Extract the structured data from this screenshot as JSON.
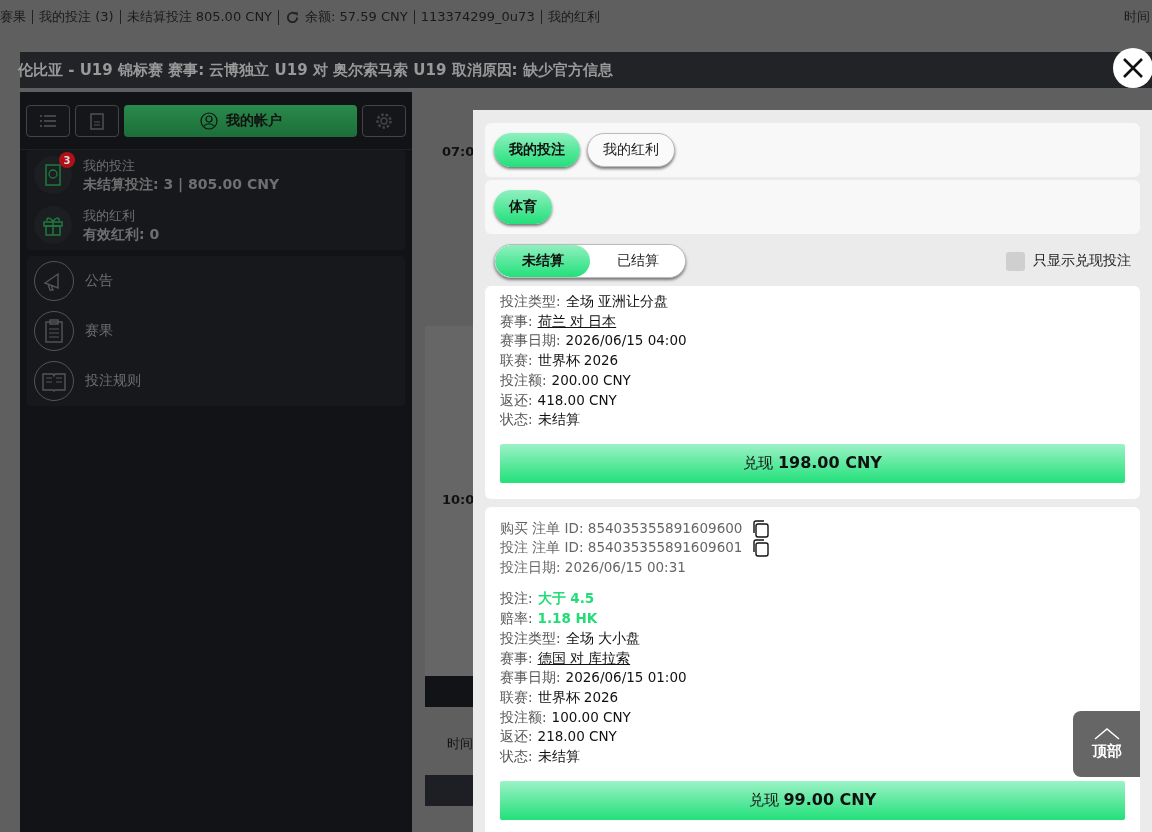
{
  "top_bar": {
    "items": [
      {
        "kind": "link",
        "text": "赛果"
      },
      {
        "kind": "link",
        "text": "我的投注 (3)"
      },
      {
        "kind": "link",
        "text": "未结算投注 805.00 CNY"
      },
      {
        "kind": "balance",
        "text": "余额:  57.59 CNY"
      },
      {
        "kind": "link",
        "text": "113374299_0u73"
      },
      {
        "kind": "link",
        "text": "我的红利"
      }
    ],
    "right": "时间"
  },
  "banner": "伦比亚 - U19 锦标赛 赛事: 云博独立 U19 对 奥尔索马索 U19 取消原因: 缺少官方信息",
  "sidebar": {
    "account_button": "我的帐户",
    "summary": [
      {
        "kind": "bets",
        "title": "我的投注",
        "detail": "未结算投注: 3 | 805.00 CNY",
        "badge": "3"
      },
      {
        "kind": "bonus",
        "title": "我的红利",
        "detail": "有效红利: 0"
      }
    ],
    "menu": [
      {
        "kind": "announcement",
        "label": "公告"
      },
      {
        "kind": "results",
        "label": "赛果"
      },
      {
        "kind": "rules",
        "label": "投注规则"
      }
    ]
  },
  "schedule": {
    "times": [
      "07:0",
      "10:0"
    ],
    "label": "时间"
  },
  "modal": {
    "tabs": [
      {
        "label": "我的投注",
        "selected": true
      },
      {
        "label": "我的红利",
        "selected": false
      }
    ],
    "categories": [
      {
        "label": "体育",
        "selected": true
      }
    ],
    "status_toggle": [
      {
        "label": "未结算",
        "selected": true
      },
      {
        "label": "已结算",
        "selected": false
      }
    ],
    "filter": {
      "label": "只显示兑现投注",
      "checked": false
    },
    "bets": [
      {
        "details": [
          {
            "kind": "text",
            "label": "投注类型:",
            "value": "全场 亚洲让分盘"
          },
          {
            "kind": "link",
            "label": "赛事:",
            "value": "荷兰 对 日本"
          },
          {
            "kind": "text",
            "label": "赛事日期:",
            "value": "2026/06/15 04:00"
          },
          {
            "kind": "text",
            "label": "联赛:",
            "value": "世界杯 2026"
          },
          {
            "kind": "text",
            "label": "投注额:",
            "value": "200.00 CNY"
          },
          {
            "kind": "text",
            "label": "返还:",
            "value": "418.00 CNY"
          },
          {
            "kind": "text",
            "label": "状态:",
            "value": "未结算"
          }
        ],
        "cashout": {
          "label": "兑现",
          "amount": "198.00 CNY"
        }
      },
      {
        "meta": [
          {
            "text": "购买 注单 ID: 854035355891609600",
            "copy": true
          },
          {
            "text": "投注 注单 ID: 854035355891609601",
            "copy": true
          },
          {
            "text": "投注日期: 2026/06/15 00:31",
            "copy": false
          }
        ],
        "details": [
          {
            "kind": "highlight",
            "label": "投注:",
            "value": "大于 4.5"
          },
          {
            "kind": "highlight",
            "label": "赔率:",
            "value": "1.18 HK"
          },
          {
            "kind": "text",
            "label": "投注类型:",
            "value": "全场 大小盘"
          },
          {
            "kind": "link",
            "label": "赛事:",
            "value": "德国 对 库拉索"
          },
          {
            "kind": "text",
            "label": "赛事日期:",
            "value": "2026/06/15 01:00"
          },
          {
            "kind": "text",
            "label": "联赛:",
            "value": "世界杯 2026"
          },
          {
            "kind": "text",
            "label": "投注额:",
            "value": "100.00 CNY"
          },
          {
            "kind": "text",
            "label": "返还:",
            "value": "218.00 CNY"
          },
          {
            "kind": "text",
            "label": "状态:",
            "value": "未结算"
          }
        ],
        "cashout": {
          "label": "兑现",
          "amount": "99.00 CNY"
        }
      }
    ]
  },
  "scroll_top": "顶部"
}
